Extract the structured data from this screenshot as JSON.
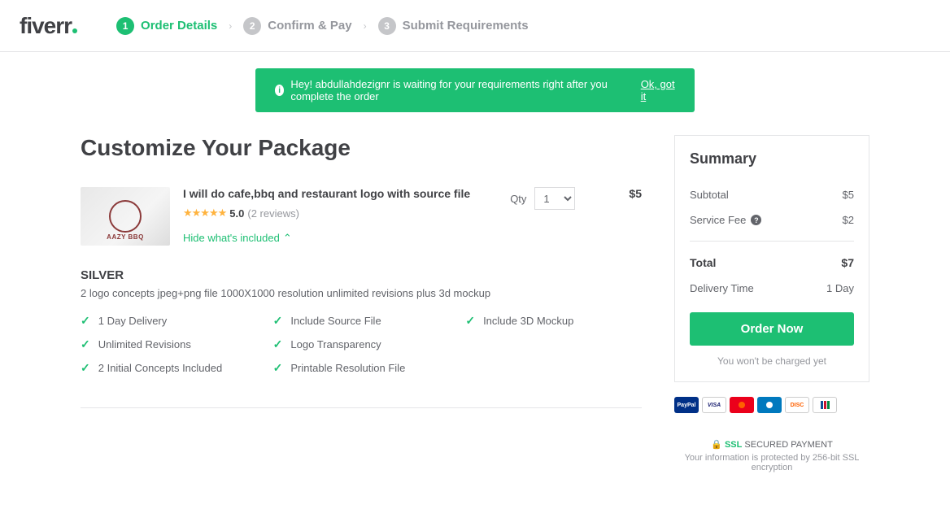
{
  "logo": "fiverr",
  "steps": {
    "s1_num": "1",
    "s1_label": "Order Details",
    "s2_num": "2",
    "s2_label": "Confirm & Pay",
    "s3_num": "3",
    "s3_label": "Submit Requirements"
  },
  "banner": {
    "text": "Hey! abdullahdezignr is waiting for your requirements right after you complete the order",
    "action": "Ok, got it"
  },
  "page_title": "Customize Your Package",
  "gig": {
    "title": "I will do cafe,bbq and restaurant logo with source file",
    "rating": "5.0",
    "reviews": "(2 reviews)",
    "hide_link": "Hide what's included",
    "qty_label": "Qty",
    "qty_value": "1",
    "price": "$5",
    "thumb_text": "AAZY BBQ"
  },
  "package": {
    "name": "SILVER",
    "desc": "2 logo concepts jpeg+png file 1000X1000 resolution unlimited revisions plus 3d mockup",
    "features": {
      "f1": "1 Day Delivery",
      "f2": "Include Source File",
      "f3": "Include 3D Mockup",
      "f4": "Unlimited Revisions",
      "f5": "Logo Transparency",
      "f6": "2 Initial Concepts Included",
      "f7": "Printable Resolution File"
    }
  },
  "summary": {
    "title": "Summary",
    "subtotal_label": "Subtotal",
    "subtotal_value": "$5",
    "fee_label": "Service Fee",
    "fee_value": "$2",
    "total_label": "Total",
    "total_value": "$7",
    "delivery_label": "Delivery Time",
    "delivery_value": "1 Day",
    "button": "Order Now",
    "note": "You won't be charged yet"
  },
  "payments": {
    "paypal": "PayPal",
    "visa": "VISA",
    "mc": "",
    "diners": "",
    "discover": "DISC",
    "jcb": "JCB"
  },
  "ssl": {
    "badge": "SSL",
    "label": "SECURED PAYMENT",
    "note": "Your information is protected by 256-bit SSL encryption"
  }
}
